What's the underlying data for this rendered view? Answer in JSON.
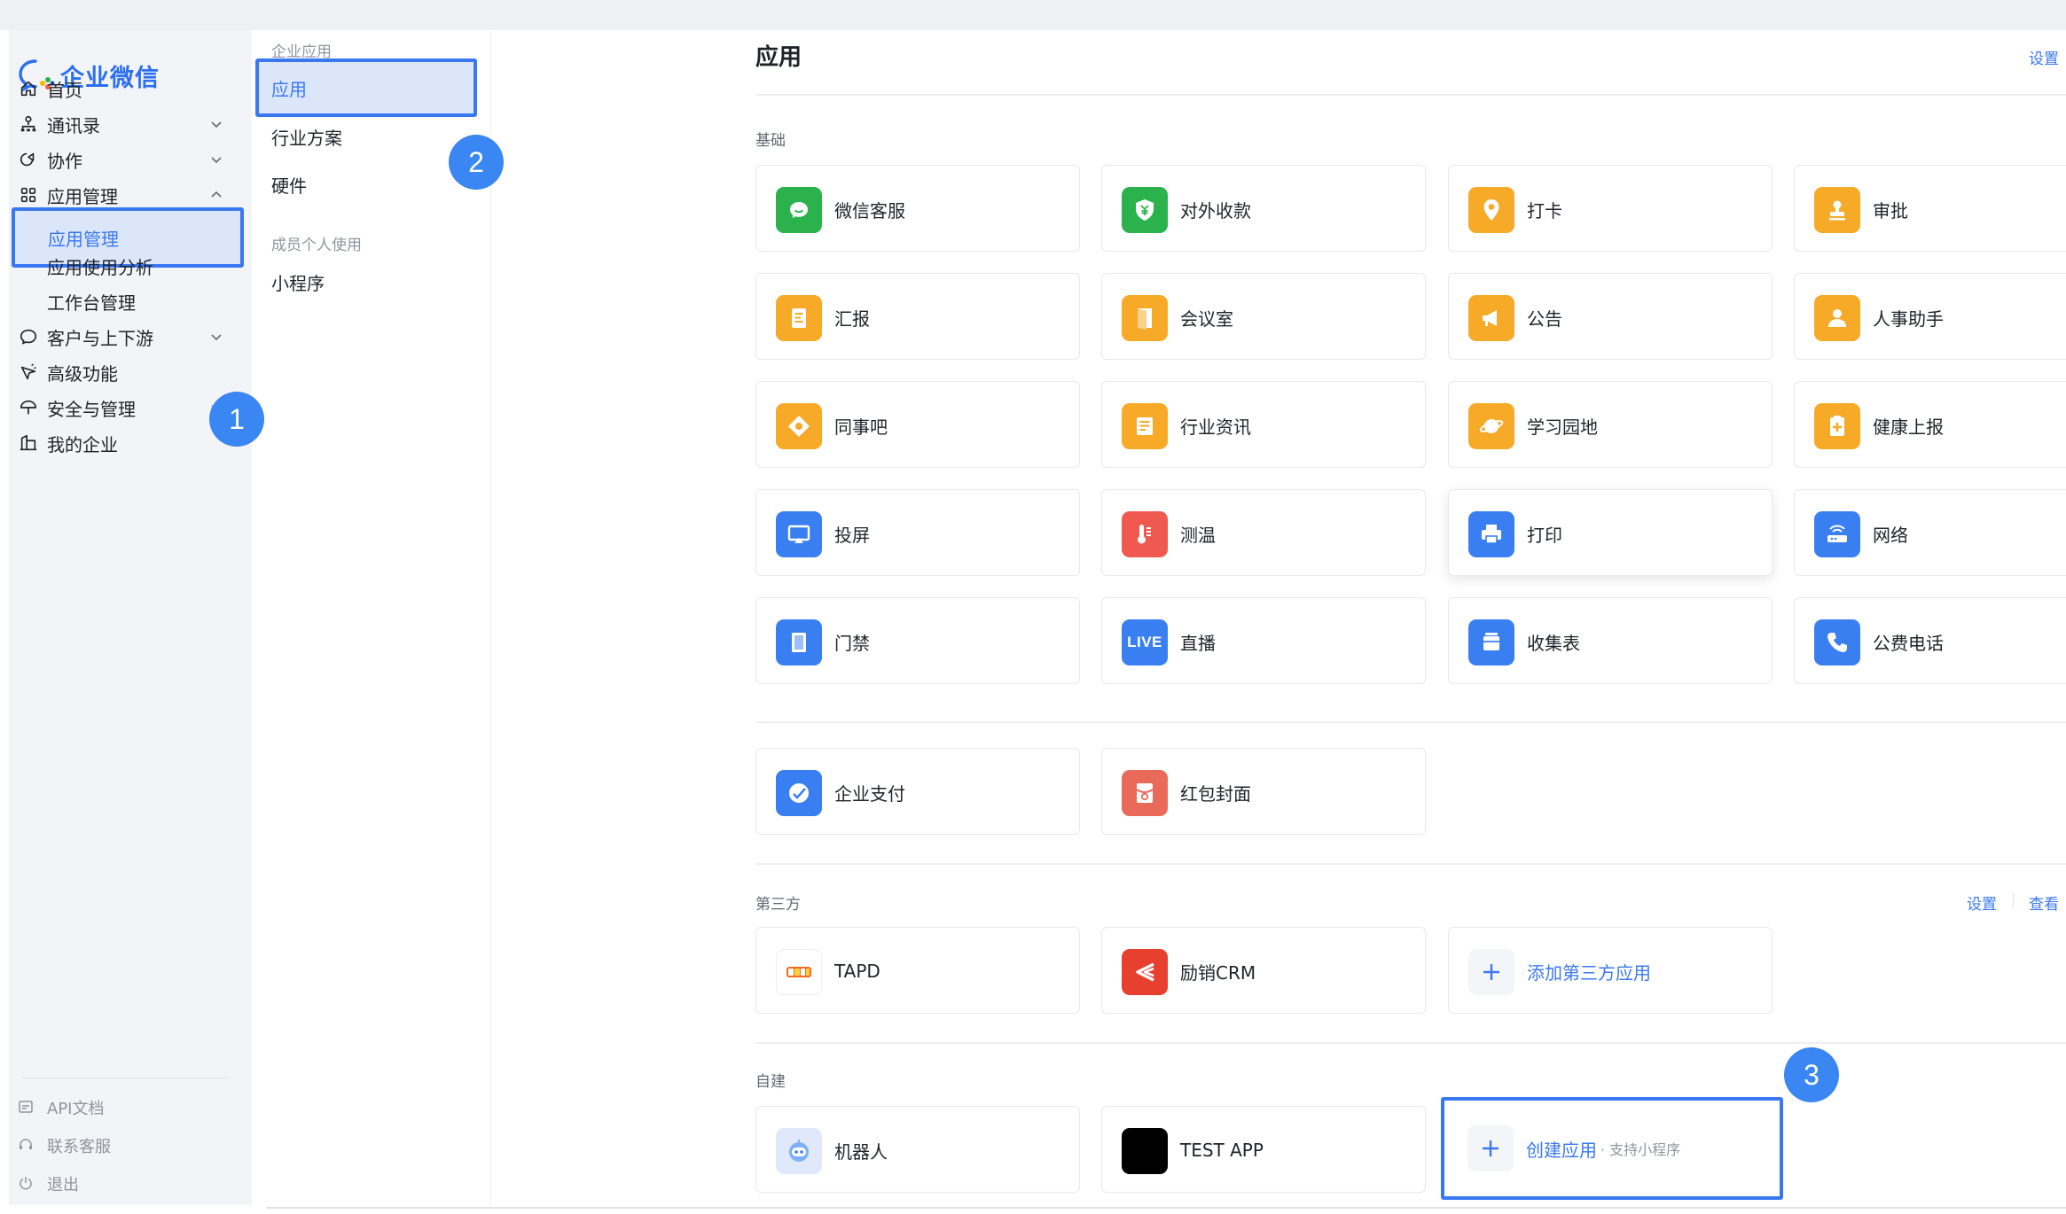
{
  "brand": {
    "name": "企业微信",
    "color": "#2b6ff2"
  },
  "accent": "#3a78f2",
  "sidebar": {
    "items": [
      {
        "id": "home",
        "label": "首页",
        "icon": "home-icon",
        "chevron": ""
      },
      {
        "id": "contacts",
        "label": "通讯录",
        "icon": "org-chart-icon",
        "chevron": "down"
      },
      {
        "id": "collab",
        "label": "协作",
        "icon": "collaboration-icon",
        "chevron": "down"
      },
      {
        "id": "appmgmt",
        "label": "应用管理",
        "icon": "grid-icon",
        "chevron": "up"
      },
      {
        "id": "customers",
        "label": "客户与上下游",
        "icon": "chat-bubble-icon",
        "chevron": "down"
      },
      {
        "id": "advanced",
        "label": "高级功能",
        "icon": "star-icon",
        "chevron": ""
      },
      {
        "id": "security",
        "label": "安全与管理",
        "icon": "umbrella-icon",
        "chevron": "down"
      },
      {
        "id": "mycorp",
        "label": "我的企业",
        "icon": "building-icon",
        "chevron": ""
      }
    ],
    "sub_items": [
      {
        "label": "应用管理",
        "active": true
      },
      {
        "label": "应用使用分析",
        "active": false
      },
      {
        "label": "工作台管理",
        "active": false
      }
    ],
    "footer": [
      {
        "label": "API文档",
        "icon": "document-icon"
      },
      {
        "label": "联系客服",
        "icon": "headset-icon"
      },
      {
        "label": "退出",
        "icon": "power-icon"
      }
    ]
  },
  "subnav": {
    "group1": "企业应用",
    "items1": [
      {
        "label": "应用",
        "active": true
      },
      {
        "label": "行业方案"
      },
      {
        "label": "硬件"
      }
    ],
    "group2": "成员个人使用",
    "items2": [
      {
        "label": "小程序"
      }
    ]
  },
  "main": {
    "title": "应用",
    "top_link": "设置",
    "basic": {
      "label": "基础",
      "apps": [
        {
          "name": "微信客服",
          "icon": "wechat-service-icon",
          "color": "#2bb24c"
        },
        {
          "name": "对外收款",
          "icon": "payment-shield-icon",
          "color": "#2bb24c"
        },
        {
          "name": "打卡",
          "icon": "location-pin-icon",
          "color": "#f7a928"
        },
        {
          "name": "审批",
          "icon": "stamp-icon",
          "color": "#f7a928"
        },
        {
          "name": "汇报",
          "icon": "report-icon",
          "color": "#f7a928"
        },
        {
          "name": "会议室",
          "icon": "door-icon",
          "color": "#f7a928"
        },
        {
          "name": "公告",
          "icon": "megaphone-icon",
          "color": "#f7a928"
        },
        {
          "name": "人事助手",
          "icon": "person-icon",
          "color": "#f7a928"
        },
        {
          "name": "同事吧",
          "icon": "diamond-icon",
          "color": "#f7a928"
        },
        {
          "name": "行业资讯",
          "icon": "news-icon",
          "color": "#f7a928"
        },
        {
          "name": "学习园地",
          "icon": "planet-icon",
          "color": "#f7a928"
        },
        {
          "name": "健康上报",
          "icon": "health-icon",
          "color": "#f7a928"
        },
        {
          "name": "投屏",
          "icon": "screen-cast-icon",
          "color": "#3a7ff2"
        },
        {
          "name": "测温",
          "icon": "thermometer-icon",
          "color": "#f0594f"
        },
        {
          "name": "打印",
          "icon": "printer-icon",
          "color": "#3a7ff2"
        },
        {
          "name": "网络",
          "icon": "router-icon",
          "color": "#3a7ff2"
        },
        {
          "name": "门禁",
          "icon": "access-door-icon",
          "color": "#3a7ff2"
        },
        {
          "name": "直播",
          "icon": "live-icon",
          "color": "#3a7ff2",
          "badge": "LIVE"
        },
        {
          "name": "收集表",
          "icon": "form-icon",
          "color": "#3a7ff2"
        },
        {
          "name": "公费电话",
          "icon": "phone-icon",
          "color": "#3a7ff2"
        }
      ],
      "extra": [
        {
          "name": "企业支付",
          "icon": "corp-pay-icon",
          "color": "#3a7ff2"
        },
        {
          "name": "红包封面",
          "icon": "red-envelope-icon",
          "color": "#ea6a5a"
        }
      ]
    },
    "third_party": {
      "label": "第三方",
      "link1": "设置",
      "link2": "查看",
      "apps": [
        {
          "name": "TAPD",
          "icon": "tapd-logo-icon"
        },
        {
          "name": "励销CRM",
          "icon": "crm-logo-icon"
        }
      ],
      "add_label": "添加第三方应用"
    },
    "custom": {
      "label": "自建",
      "apps": [
        {
          "name": "机器人",
          "icon": "robot-icon"
        },
        {
          "name": "TEST APP",
          "icon": "black-square-icon"
        }
      ],
      "create_label": "创建应用",
      "create_note": "· 支持小程序"
    }
  },
  "markers": [
    "1",
    "2",
    "3"
  ]
}
